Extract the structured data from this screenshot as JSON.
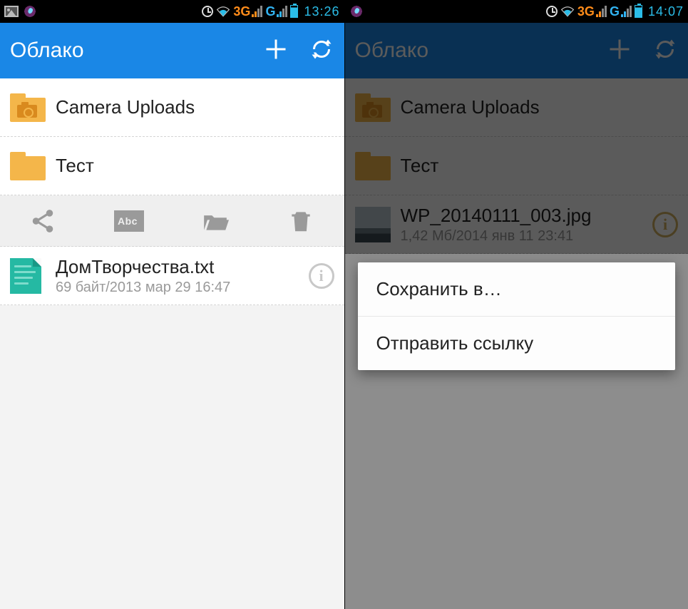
{
  "left": {
    "status": {
      "net1": "3G",
      "net2": "G",
      "time": "13:26"
    },
    "app_title": "Облако",
    "items": [
      {
        "name": "Camera Uploads",
        "type": "folder-cam"
      },
      {
        "name": "Тест",
        "type": "folder"
      }
    ],
    "file": {
      "name": "ДомТворчества.txt",
      "meta": "69 байт/2013 мар 29 16:47"
    }
  },
  "right": {
    "status": {
      "net1": "3G",
      "net2": "G",
      "time": "14:07"
    },
    "app_title": "Облако",
    "items": [
      {
        "name": "Camera Uploads",
        "type": "folder-cam"
      },
      {
        "name": "Тест",
        "type": "folder"
      }
    ],
    "file": {
      "name": "WP_20140111_003.jpg",
      "meta": "1,42 Мб/2014 янв 11 23:41"
    },
    "popup": {
      "save_in": "Сохранить в…",
      "send_link": "Отправить ссылку"
    }
  },
  "actions": {
    "share": "share",
    "rename": "Abc",
    "open": "open",
    "delete": "delete"
  }
}
